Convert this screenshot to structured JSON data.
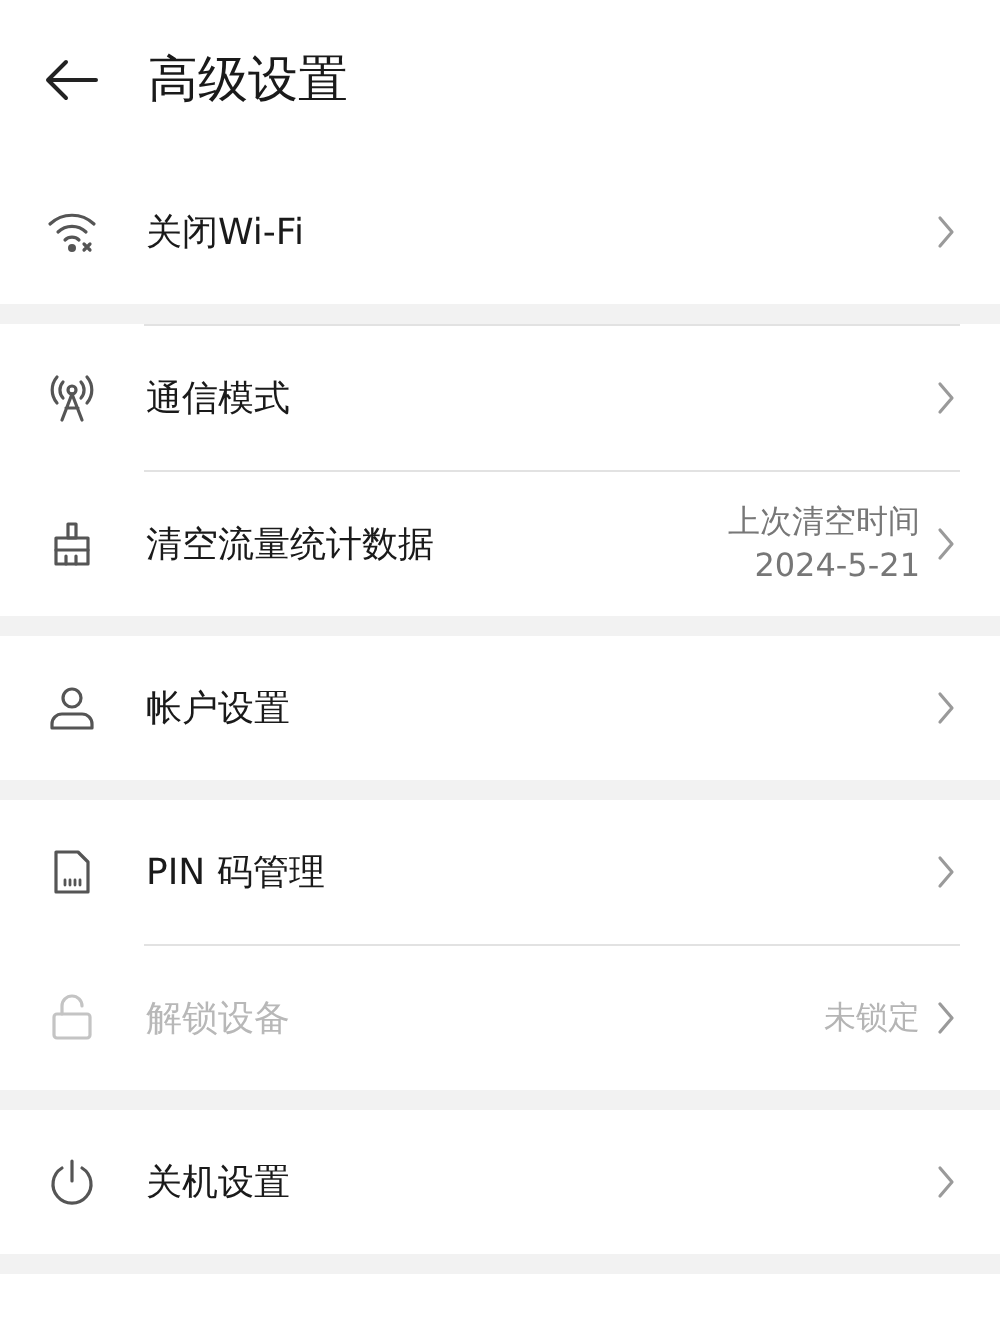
{
  "header": {
    "title": "高级设置"
  },
  "groups": [
    {
      "items": [
        {
          "label": "关闭Wi-Fi",
          "disabled": false
        }
      ]
    },
    {
      "items": [
        {
          "label": "通信模式",
          "disabled": false
        },
        {
          "label": "清空流量统计数据",
          "value_lines": [
            "上次清空时间",
            "2024-5-21"
          ],
          "disabled": false
        }
      ]
    },
    {
      "items": [
        {
          "label": "帐户设置",
          "disabled": false
        }
      ]
    },
    {
      "items": [
        {
          "label": "PIN 码管理",
          "disabled": false
        },
        {
          "label": "解锁设备",
          "value_lines": [
            "未锁定"
          ],
          "disabled": true
        }
      ]
    },
    {
      "items": [
        {
          "label": "关机设置",
          "disabled": false
        }
      ]
    }
  ]
}
